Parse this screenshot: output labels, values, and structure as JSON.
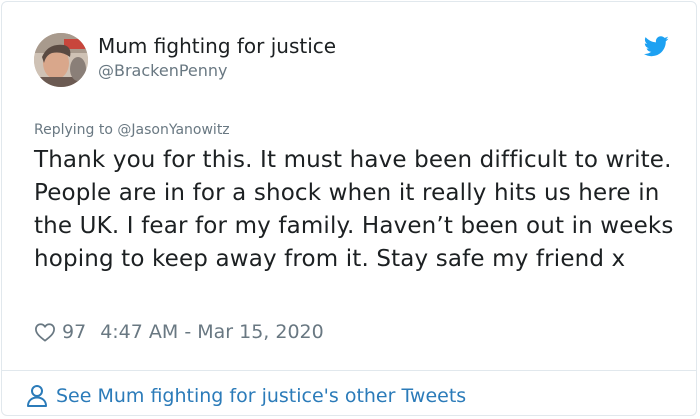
{
  "tweet": {
    "author_name": "Mum fighting for justice",
    "author_handle": "@BrackenPenny",
    "reply_prefix": "Replying to ",
    "reply_mention": "@JasonYanowitz",
    "text": "Thank you for this. It must have been difficult to write. People are in for a shock when it really hits us here in the UK. I fear for my family. Haven’t been out in weeks hoping to keep away from it. Stay safe my friend x",
    "likes": "97",
    "timestamp": "4:47 AM - Mar 15, 2020"
  },
  "footer": {
    "link_text": "See Mum fighting for justice's other Tweets"
  },
  "icons": {
    "brand": "twitter-bird-icon",
    "like": "heart-icon",
    "profile": "person-icon"
  },
  "colors": {
    "link_blue": "#2b7bb9",
    "twitter_blue": "#1da1f2",
    "text": "#1c2022",
    "muted": "#697882",
    "border": "#e1e8ed"
  }
}
